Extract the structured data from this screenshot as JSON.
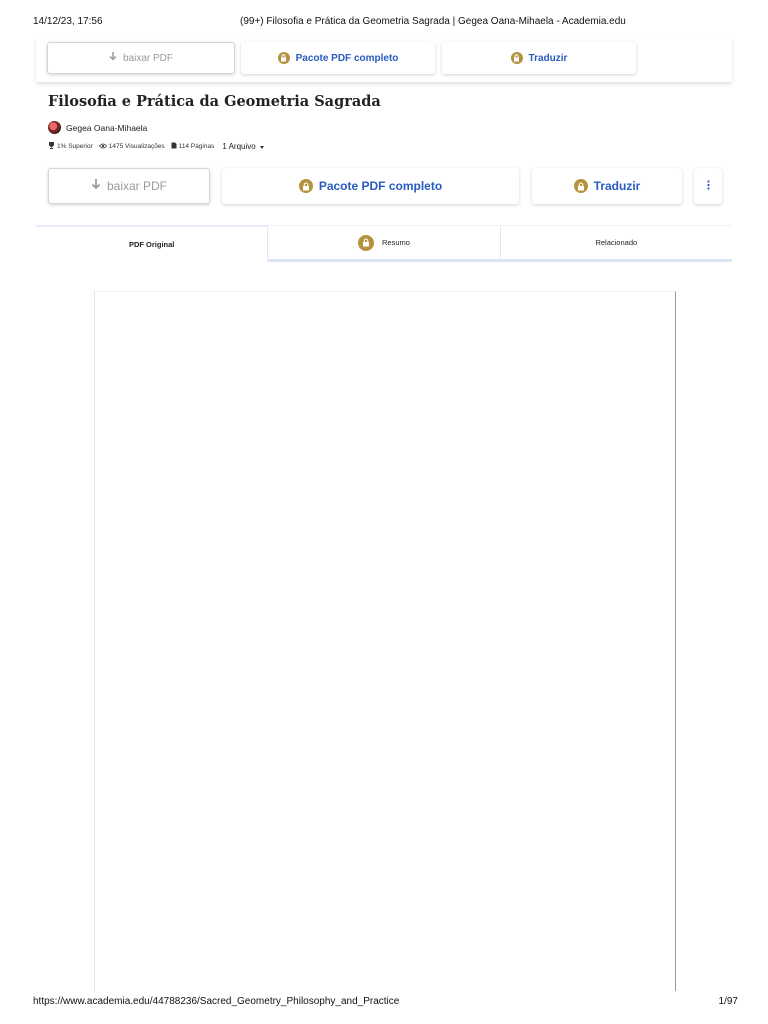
{
  "print": {
    "date": "14/12/23, 17:56",
    "title": "(99+) Filosofia e Prática da Geometria Sagrada | Gegea Oana-Mihaela - Academia.edu",
    "url": "https://www.academia.edu/44788236/Sacred_Geometry_Philosophy_and_Practice",
    "page": "1/97"
  },
  "top_bar": {
    "download": "baixar PDF",
    "bundle": "Pacote PDF completo",
    "translate": "Traduzir"
  },
  "document": {
    "title": "Filosofia e Prática da Geometria Sagrada",
    "author": "Gegea Oana-Mihaela",
    "rank": "1% Superior",
    "views": "1475 Visualizações",
    "pages": "114 Páginas",
    "files": "1 Arquivo"
  },
  "actions": {
    "download": "baixar PDF",
    "bundle": "Pacote PDF completo",
    "translate": "Traduzir"
  },
  "tabs": [
    {
      "label": "PDF Original"
    },
    {
      "label": "Resumo"
    },
    {
      "label": "Relacionado"
    }
  ],
  "colors": {
    "accent_blue": "#2a5bbe",
    "lock_gold": "#b5923d",
    "disabled_gray": "#9a9a9a"
  },
  "icons": {
    "download": "down-arrow-icon",
    "lock": "lock-icon",
    "more": "vertical-dots-icon",
    "trophy": "trophy-icon",
    "views": "eye-icon",
    "pages": "file-icon",
    "dropdown": "caret-down-icon"
  }
}
